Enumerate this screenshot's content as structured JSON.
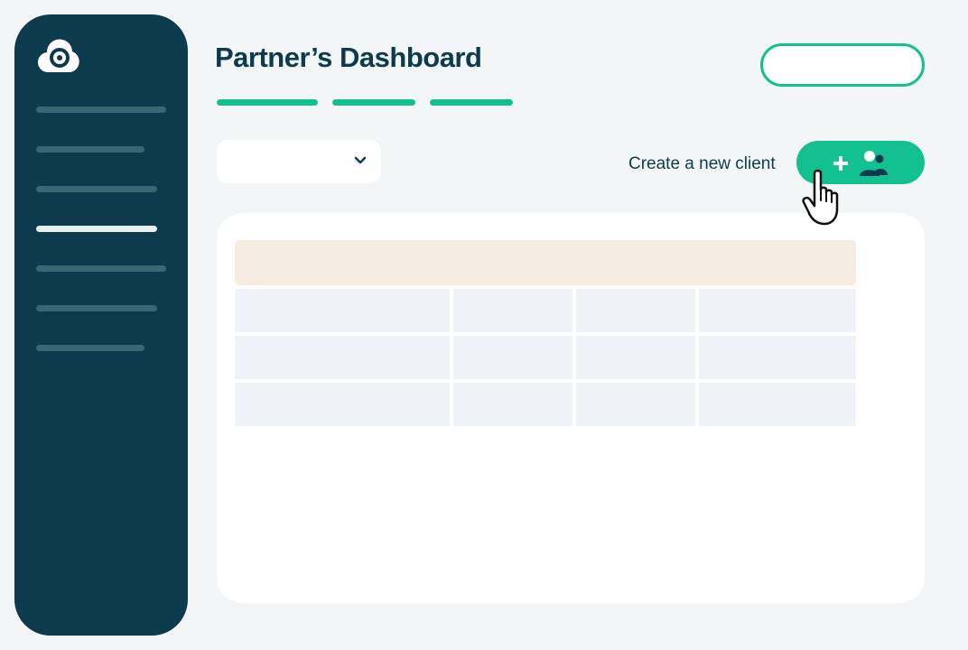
{
  "page": {
    "title": "Partner’s Dashboard"
  },
  "actions": {
    "create_client_label": "Create a new client"
  },
  "icons": {
    "logo": "spiral-logo",
    "select_chevron": "chevron-down-icon",
    "add": "plus-icon",
    "users": "users-icon",
    "cursor": "hand-pointer-icon"
  },
  "colors": {
    "sidebar": "#0d3a4c",
    "accent": "#13c08f",
    "table_header": "#f5ede1",
    "table_cell": "#eff2f6"
  },
  "sidebar": {
    "items": 7,
    "active_item": 4
  },
  "tabs": {
    "count": 3
  },
  "table": {
    "columns": 4,
    "rows": 3
  }
}
